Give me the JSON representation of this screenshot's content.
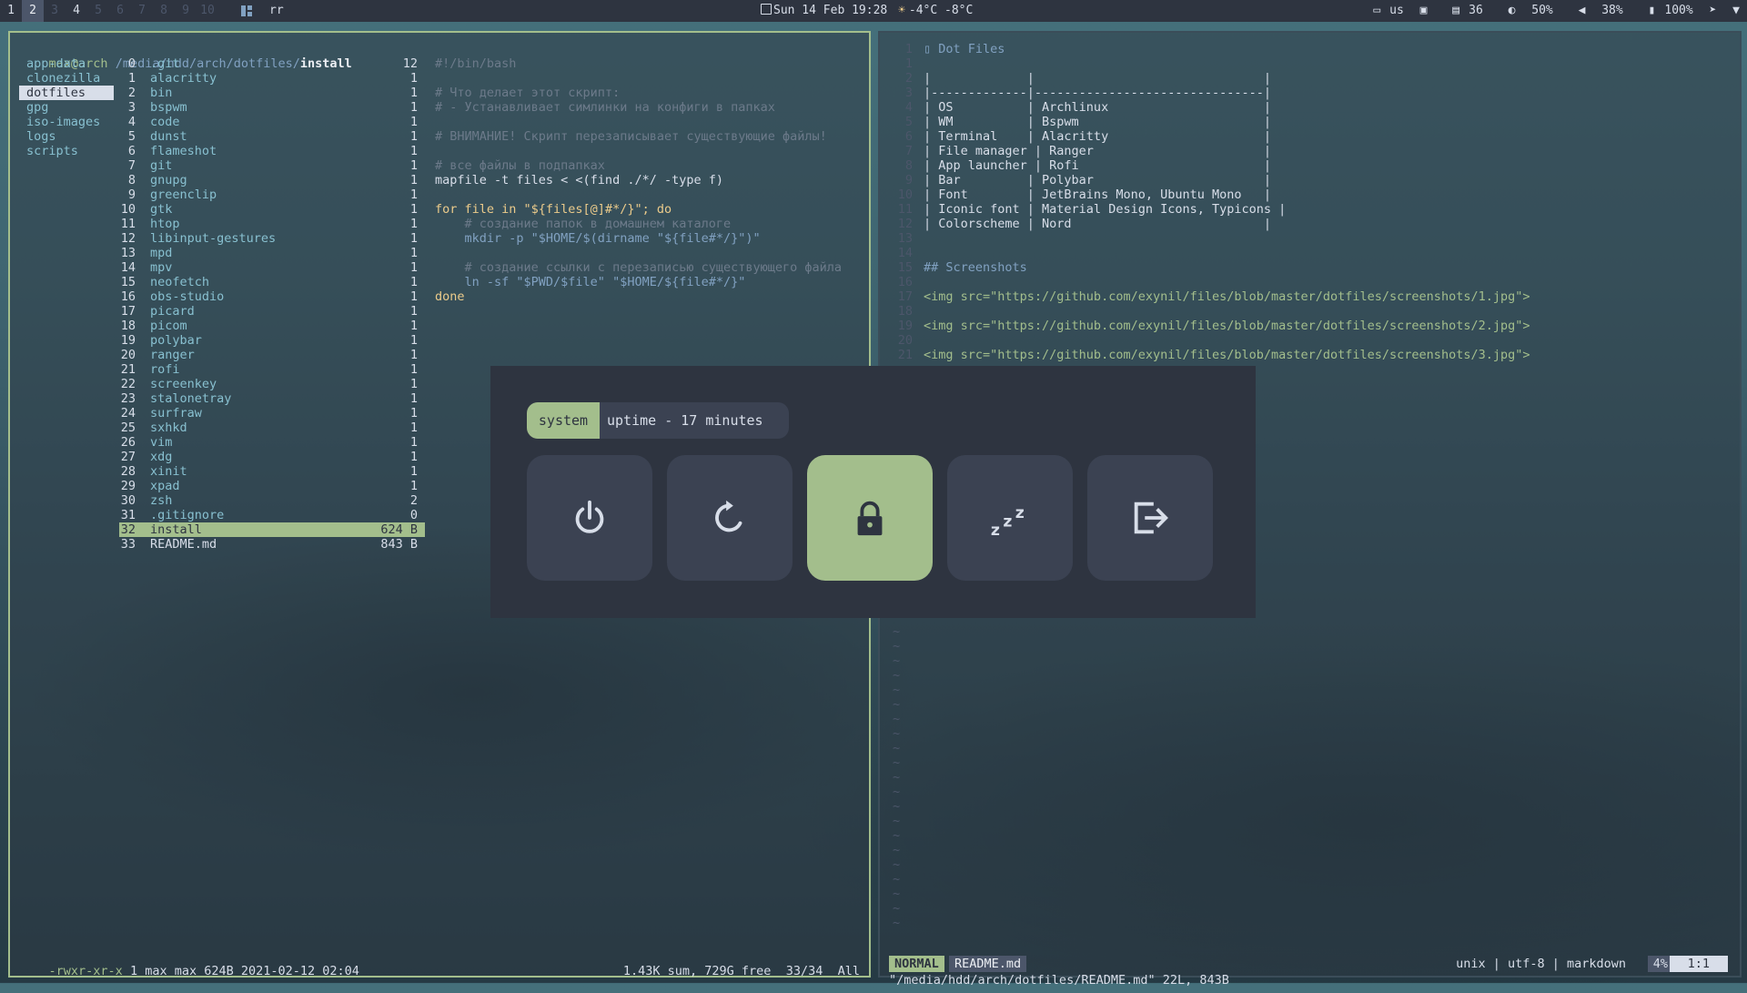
{
  "topbar": {
    "workspaces": [
      {
        "label": "1",
        "state": "occupied"
      },
      {
        "label": "2",
        "state": "focused"
      },
      {
        "label": "3",
        "state": "empty"
      },
      {
        "label": "4",
        "state": "occupied"
      },
      {
        "label": "5",
        "state": "empty"
      },
      {
        "label": "6",
        "state": "empty"
      },
      {
        "label": "7",
        "state": "empty"
      },
      {
        "label": "8",
        "state": "empty"
      },
      {
        "label": "9",
        "state": "empty"
      },
      {
        "label": "10",
        "state": "empty"
      }
    ],
    "layout_icon": "tiled-layout-icon",
    "layout_label": "rr",
    "clock": "Sun 14 Feb 19:28",
    "weather": "-4°C -8°C",
    "keyboard": "us",
    "memory": "36",
    "brightness": "50%",
    "volume": "38%",
    "battery": "100%"
  },
  "ranger": {
    "user": "max@arch",
    "path": "/media/hdd/arch/dotfiles/",
    "current": "install",
    "parent_items": [
      "app-data",
      "clonezilla",
      "dotfiles",
      "gpg",
      "iso-images",
      "logs",
      "scripts"
    ],
    "parent_selected": "dotfiles",
    "files": [
      {
        "n": "0",
        "name": ".git",
        "c": "12"
      },
      {
        "n": "1",
        "name": "alacritty",
        "c": "1"
      },
      {
        "n": "2",
        "name": "bin",
        "c": "1"
      },
      {
        "n": "3",
        "name": "bspwm",
        "c": "1"
      },
      {
        "n": "4",
        "name": "code",
        "c": "1"
      },
      {
        "n": "5",
        "name": "dunst",
        "c": "1"
      },
      {
        "n": "6",
        "name": "flameshot",
        "c": "1"
      },
      {
        "n": "7",
        "name": "git",
        "c": "1"
      },
      {
        "n": "8",
        "name": "gnupg",
        "c": "1"
      },
      {
        "n": "9",
        "name": "greenclip",
        "c": "1"
      },
      {
        "n": "10",
        "name": "gtk",
        "c": "1"
      },
      {
        "n": "11",
        "name": "htop",
        "c": "1"
      },
      {
        "n": "12",
        "name": "libinput-gestures",
        "c": "1"
      },
      {
        "n": "13",
        "name": "mpd",
        "c": "1"
      },
      {
        "n": "14",
        "name": "mpv",
        "c": "1"
      },
      {
        "n": "15",
        "name": "neofetch",
        "c": "1"
      },
      {
        "n": "16",
        "name": "obs-studio",
        "c": "1"
      },
      {
        "n": "17",
        "name": "picard",
        "c": "1"
      },
      {
        "n": "18",
        "name": "picom",
        "c": "1"
      },
      {
        "n": "19",
        "name": "polybar",
        "c": "1"
      },
      {
        "n": "20",
        "name": "ranger",
        "c": "1"
      },
      {
        "n": "21",
        "name": "rofi",
        "c": "1"
      },
      {
        "n": "22",
        "name": "screenkey",
        "c": "1"
      },
      {
        "n": "23",
        "name": "stalonetray",
        "c": "1"
      },
      {
        "n": "24",
        "name": "surfraw",
        "c": "1"
      },
      {
        "n": "25",
        "name": "sxhkd",
        "c": "1"
      },
      {
        "n": "26",
        "name": "vim",
        "c": "1"
      },
      {
        "n": "27",
        "name": "xdg",
        "c": "1"
      },
      {
        "n": "28",
        "name": "xinit",
        "c": "1"
      },
      {
        "n": "29",
        "name": "xpad",
        "c": "1"
      },
      {
        "n": "30",
        "name": "zsh",
        "c": "2"
      },
      {
        "n": "31",
        "name": ".gitignore",
        "c": "0"
      },
      {
        "n": "32",
        "name": "install",
        "c": "624 B"
      },
      {
        "n": "33",
        "name": "README.md",
        "c": "843 B"
      }
    ],
    "selected_file": "install",
    "preview": [
      "#!/bin/bash",
      "",
      "# Что делает этот скрипт:",
      "# - Устанавливает симлинки на конфиги в папках",
      "",
      "# ВНИМАНИЕ! Скрипт перезаписывает существующие файлы!",
      "",
      "# все файлы в подпапках",
      "mapfile -t files < <(find ./*/ -type f)",
      "",
      "for file in \"${files[@]#*/}\"; do",
      "    # создание папок в домашнем каталоге",
      "    mkdir -p \"$HOME/$(dirname \"${file#*/}\")\"",
      "",
      "    # создание ссылки с перезаписью существующего файла",
      "    ln -sf \"$PWD/$file\" \"$HOME/${file#*/}\"",
      "done"
    ],
    "status_perms": "-rwxr-xr-x",
    "status_info": "1 max max 624B 2021-02-12 02:04",
    "status_summary": "1.43K sum, 729G free",
    "status_pos": "33/34",
    "status_all": "All"
  },
  "vim": {
    "lines": [
      {
        "ln": "1",
        "text": "▯ Dot Files",
        "kind": "head"
      },
      {
        "ln": "1",
        "text": "",
        "kind": "text"
      },
      {
        "ln": "2",
        "text": "|             |                               |",
        "kind": "text"
      },
      {
        "ln": "3",
        "text": "|-------------|-------------------------------|",
        "kind": "text"
      },
      {
        "ln": "4",
        "text": "| OS          | Archlinux                     |",
        "kind": "text"
      },
      {
        "ln": "5",
        "text": "| WM          | Bspwm                         |",
        "kind": "text"
      },
      {
        "ln": "6",
        "text": "| Terminal    | Alacritty                     |",
        "kind": "text"
      },
      {
        "ln": "7",
        "text": "| File manager | Ranger                       |",
        "kind": "text"
      },
      {
        "ln": "8",
        "text": "| App launcher | Rofi                         |",
        "kind": "text"
      },
      {
        "ln": "9",
        "text": "| Bar         | Polybar                       |",
        "kind": "text"
      },
      {
        "ln": "10",
        "text": "| Font        | JetBrains Mono, Ubuntu Mono   |",
        "kind": "text"
      },
      {
        "ln": "11",
        "text": "| Iconic font | Material Design Icons, Typicons |",
        "kind": "text"
      },
      {
        "ln": "12",
        "text": "| Colorscheme | Nord                          |",
        "kind": "text"
      },
      {
        "ln": "13",
        "text": "",
        "kind": "text"
      },
      {
        "ln": "14",
        "text": "",
        "kind": "text"
      },
      {
        "ln": "15",
        "text": "## Screenshots",
        "kind": "head"
      },
      {
        "ln": "16",
        "text": "",
        "kind": "text"
      },
      {
        "ln": "17",
        "text": "<img src=\"https://github.com/exynil/files/blob/master/dotfiles/screenshots/1.jpg\">",
        "kind": "link"
      },
      {
        "ln": "18",
        "text": "",
        "kind": "text"
      },
      {
        "ln": "19",
        "text": "<img src=\"https://github.com/exynil/files/blob/master/dotfiles/screenshots/2.jpg\">",
        "kind": "link"
      },
      {
        "ln": "20",
        "text": "",
        "kind": "text"
      },
      {
        "ln": "21",
        "text": "<img src=\"https://github.com/exynil/files/blob/master/dotfiles/screenshots/3.jpg\">",
        "kind": "link"
      }
    ],
    "mode": "NORMAL",
    "file": "README.md",
    "info": "unix | utf-8 | markdown",
    "percent": "4%",
    "position": "1:1",
    "message": "\"/media/hdd/arch/dotfiles/README.md\" 22L, 843B"
  },
  "powermenu": {
    "prompt": "system",
    "uptime": "uptime - 17 minutes",
    "buttons": [
      {
        "name": "shutdown-button",
        "icon": "power-icon",
        "active": false
      },
      {
        "name": "reboot-button",
        "icon": "reboot-icon",
        "active": false
      },
      {
        "name": "lock-button",
        "icon": "lock-icon",
        "active": true
      },
      {
        "name": "suspend-button",
        "icon": "sleep-icon",
        "active": false
      },
      {
        "name": "logout-button",
        "icon": "logout-icon",
        "active": false
      }
    ]
  },
  "colors": {
    "accent": "#a3be8c",
    "bar_bg": "#2e3440",
    "panel_bg": "#3b4252",
    "text": "#d8dee9"
  }
}
